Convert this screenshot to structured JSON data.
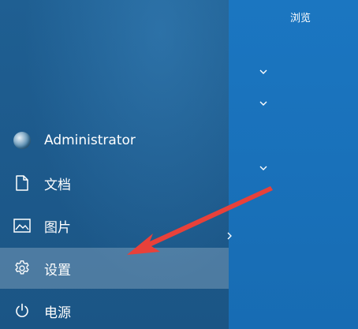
{
  "tiles": {
    "browse_label": "浏览"
  },
  "user": {
    "name": "Administrator"
  },
  "menu": {
    "items": [
      {
        "label": "文档",
        "icon": "document-icon"
      },
      {
        "label": "图片",
        "icon": "pictures-icon"
      },
      {
        "label": "设置",
        "icon": "gear-icon",
        "active": true
      },
      {
        "label": "电源",
        "icon": "power-icon"
      }
    ]
  },
  "colors": {
    "start_pane": "#1d5a8c",
    "tiles_pane": "#1b76c1",
    "active_highlight": "#4d86b4",
    "arrow": "#e8413a",
    "text": "#ffffff"
  }
}
